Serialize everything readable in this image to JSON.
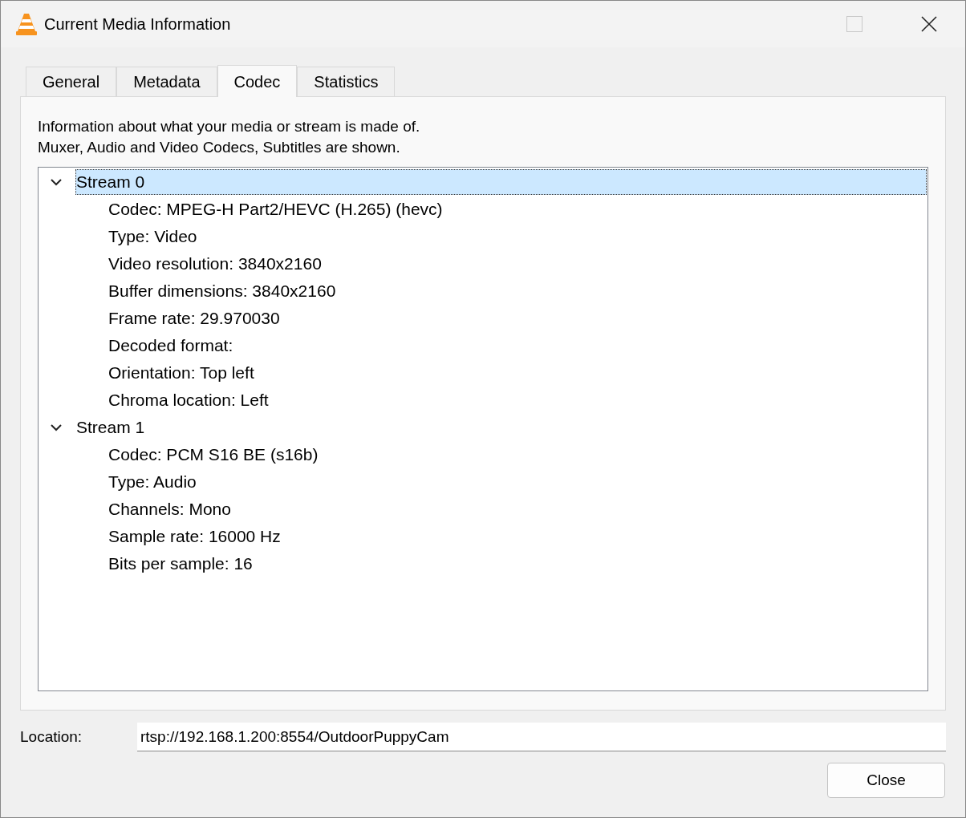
{
  "window": {
    "title": "Current Media Information",
    "maximize_disabled": true
  },
  "tabs": [
    {
      "label": "General",
      "selected": false
    },
    {
      "label": "Metadata",
      "selected": false
    },
    {
      "label": "Codec",
      "selected": true
    },
    {
      "label": "Statistics",
      "selected": false
    }
  ],
  "description": [
    "Information about what your media or stream is made of.",
    "Muxer, Audio and Video Codecs, Subtitles are shown."
  ],
  "tree": [
    {
      "label": "Stream 0",
      "expanded": true,
      "selected": true,
      "children": [
        {
          "label": "Codec: MPEG-H Part2/HEVC (H.265) (hevc)"
        },
        {
          "label": "Type: Video"
        },
        {
          "label": "Video resolution: 3840x2160"
        },
        {
          "label": "Buffer dimensions: 3840x2160"
        },
        {
          "label": "Frame rate: 29.970030"
        },
        {
          "label": "Decoded format:"
        },
        {
          "label": "Orientation: Top left"
        },
        {
          "label": "Chroma location: Left"
        }
      ]
    },
    {
      "label": "Stream 1",
      "expanded": true,
      "selected": false,
      "children": [
        {
          "label": "Codec: PCM S16 BE (s16b)"
        },
        {
          "label": "Type: Audio"
        },
        {
          "label": "Channels: Mono"
        },
        {
          "label": "Sample rate: 16000 Hz"
        },
        {
          "label": "Bits per sample: 16"
        }
      ]
    }
  ],
  "location": {
    "label": "Location:",
    "value": "rtsp://192.168.1.200:8554/OutdoorPuppyCam"
  },
  "close_button": {
    "label": "Close"
  }
}
